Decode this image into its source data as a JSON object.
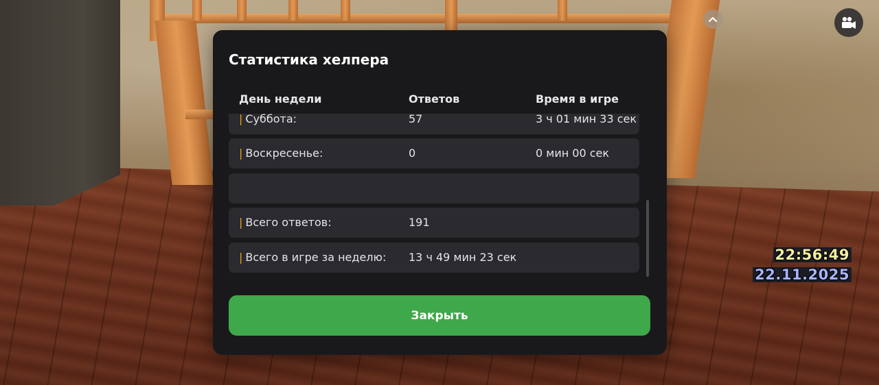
{
  "dialog": {
    "title": "Статистика хелпера",
    "columns": [
      "День недели",
      "Ответов",
      "Время в игре"
    ],
    "rows": [
      {
        "day": "Суббота:",
        "answers": "57",
        "time": "3 ч 01 мин 33 сек"
      },
      {
        "day": "Воскресенье:",
        "answers": "0",
        "time": "0 мин 00 сек"
      },
      {
        "day": "",
        "answers": "",
        "time": ""
      },
      {
        "day": "Всего ответов:",
        "answers": "191",
        "time": ""
      },
      {
        "day": "Всего в игре за неделю:",
        "answers": "13 ч 49 мин 23 сек",
        "time": ""
      }
    ],
    "row_marker": "|",
    "close_label": "Закрыть"
  },
  "hud": {
    "time": "22:56:49",
    "date": "22.11.2025",
    "collapse_icon": "chevron-up-icon",
    "camera_icon": "video-camera-icon"
  },
  "colors": {
    "accent_marker": "#e8a21a",
    "close_button": "#3ea84a",
    "panel": "#19191c",
    "row": "#2a2a2f"
  }
}
